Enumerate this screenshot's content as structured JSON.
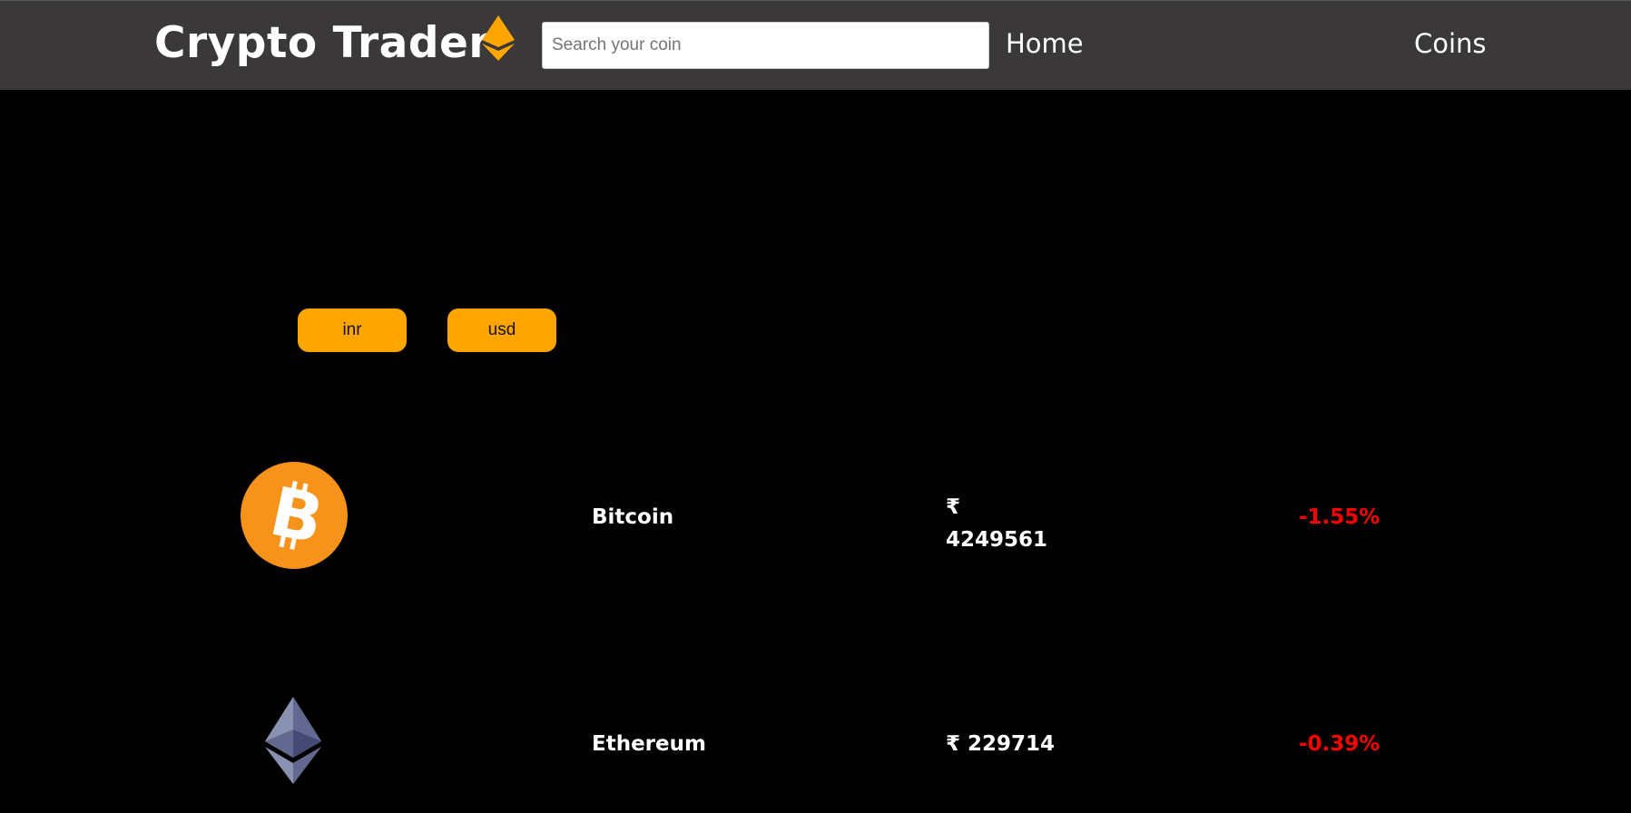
{
  "app": {
    "title": "Crypto Trader",
    "accent_color": "#ffa500",
    "nav_background": "#3a3839"
  },
  "navbar": {
    "brand_icon": "ethereum-diamond-icon",
    "search": {
      "placeholder": "Search your coin",
      "value": ""
    },
    "links": [
      {
        "label": "Home"
      },
      {
        "label": "Coins"
      }
    ]
  },
  "currency_toggle": {
    "buttons": [
      {
        "label": "inr"
      },
      {
        "label": "usd"
      }
    ]
  },
  "coins": [
    {
      "icon": "bitcoin-icon",
      "name": "Bitcoin",
      "currency_symbol": "₹",
      "price": "4249561",
      "change": "-1.55%",
      "change_color": "#ff0000"
    },
    {
      "icon": "ethereum-icon",
      "name": "Ethereum",
      "currency_symbol": "₹",
      "price": "229714",
      "change": "-0.39%",
      "change_color": "#ff0000"
    }
  ]
}
